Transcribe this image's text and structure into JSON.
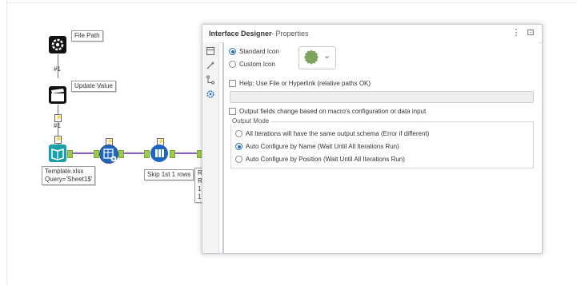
{
  "workflow": {
    "tools": {
      "file_path": {
        "label": "File Path",
        "icon": "gear-icon"
      },
      "update_value": {
        "label": "Update Value",
        "icon": "clapper-icon"
      },
      "input": {
        "label_line1": "Template.xlsx",
        "label_line2": "Query='Sheet1$'",
        "icon": "book-icon"
      },
      "dynamic_input": {
        "icon": "table-plus-icon"
      },
      "skip_rows": {
        "label": "Skip 1st 1 rows",
        "icon": "sample-icon"
      },
      "truncated_lines": [
        "R",
        "R",
        "1",
        "1"
      ]
    },
    "connection_labels": [
      "#1",
      "#1"
    ],
    "bolt_glyph": "⚡"
  },
  "panel": {
    "title": "Interface Designer",
    "subtitle": "- Properties",
    "menu_glyph": "⋮",
    "pin_glyph": "⊡",
    "side_icons": [
      "layout-icon",
      "wand-icon",
      "tree-icon",
      "gear-icon"
    ],
    "icon_options": {
      "standard": "Standard Icon",
      "custom": "Custom Icon",
      "selected": "Standard Icon",
      "swatch_color": "#7fa45b",
      "dropdown_glyph": "⌄"
    },
    "help": {
      "label": "Help: Use File or Hyperlink (relative paths OK)",
      "checked": false,
      "value": ""
    },
    "output_fields": {
      "label": "Output fields change based on macro's configuration or data input",
      "checked": false
    },
    "output_mode": {
      "title": "Output Mode",
      "options": [
        {
          "label": "All Iterations will have the same output schema (Error if different)",
          "selected": false
        },
        {
          "label": "Auto Configure by Name (Wait Until All Iterations Run)",
          "selected": true
        },
        {
          "label": "Auto Configure by Position (Wait Until All Iterations Run)",
          "selected": false
        }
      ]
    }
  },
  "colors": {
    "accent": "#2a6ebb",
    "connection": "#8a63c8",
    "anchor": "#9ec94f",
    "input_tool": "#1aa0a8",
    "blue_tool": "#1f66c1"
  }
}
